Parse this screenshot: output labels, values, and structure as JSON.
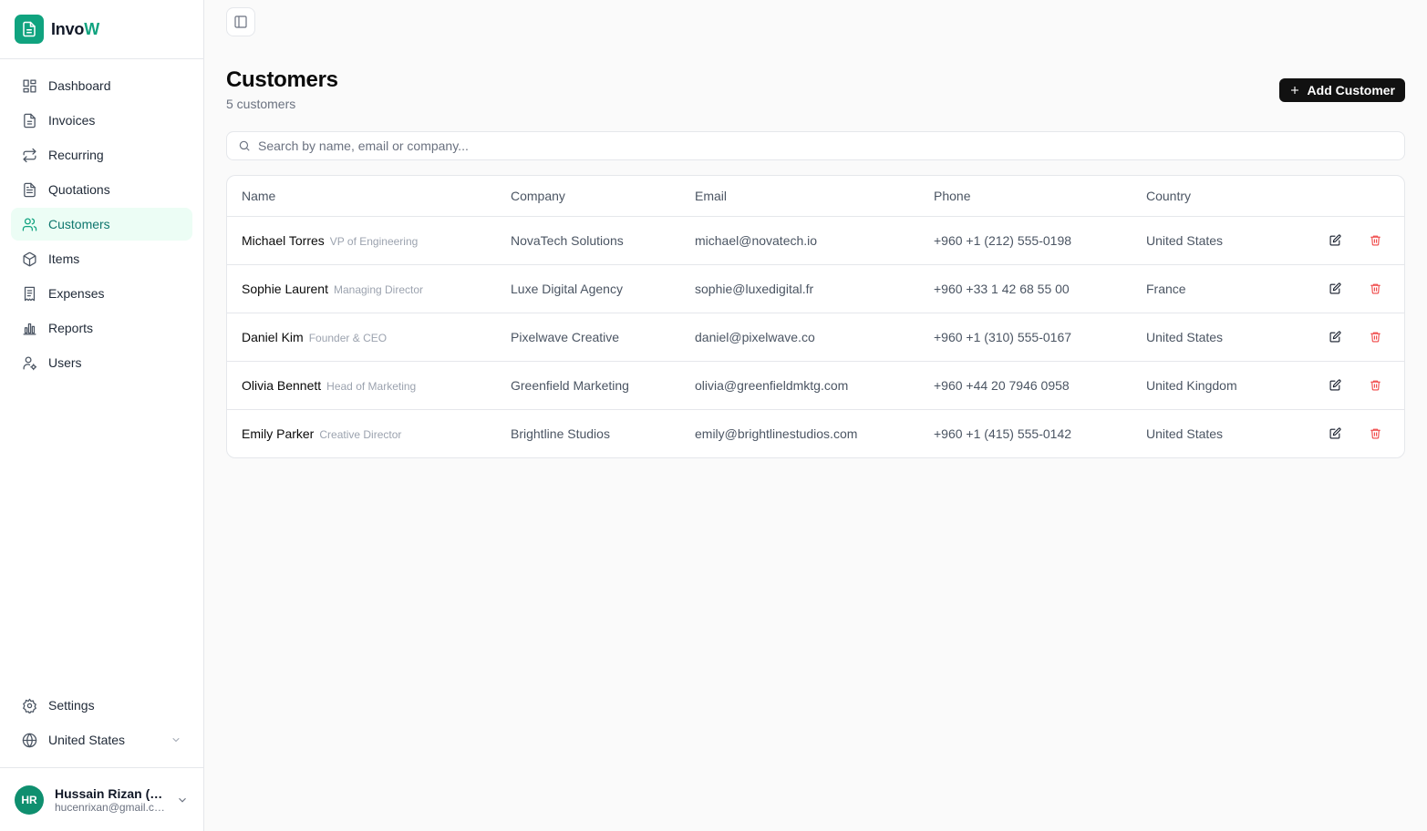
{
  "brand": {
    "name_main": "Invo",
    "name_accent": "W"
  },
  "sidebar": {
    "items": [
      {
        "label": "Dashboard",
        "icon": "dashboard-icon"
      },
      {
        "label": "Invoices",
        "icon": "file-text-icon"
      },
      {
        "label": "Recurring",
        "icon": "repeat-icon"
      },
      {
        "label": "Quotations",
        "icon": "file-lines-icon"
      },
      {
        "label": "Customers",
        "icon": "users-icon",
        "active": true
      },
      {
        "label": "Items",
        "icon": "package-icon"
      },
      {
        "label": "Expenses",
        "icon": "receipt-icon"
      },
      {
        "label": "Reports",
        "icon": "bar-chart-icon"
      },
      {
        "label": "Users",
        "icon": "user-cog-icon"
      }
    ],
    "settings_label": "Settings",
    "country_label": "United States"
  },
  "user": {
    "initials": "HR",
    "name": "Hussain Rizan (Ex",
    "email": "hucenrixan@gmail.com"
  },
  "header": {
    "title": "Customers",
    "subtitle": "5 customers",
    "add_button": "Add Customer"
  },
  "search": {
    "placeholder": "Search by name, email or company..."
  },
  "table": {
    "columns": [
      "Name",
      "Company",
      "Email",
      "Phone",
      "Country"
    ],
    "rows": [
      {
        "name": "Michael Torres",
        "role": "VP of Engineering",
        "company": "NovaTech Solutions",
        "email": "michael@novatech.io",
        "phone": "+960 +1 (212) 555-0198",
        "country": "United States"
      },
      {
        "name": "Sophie Laurent",
        "role": "Managing Director",
        "company": "Luxe Digital Agency",
        "email": "sophie@luxedigital.fr",
        "phone": "+960 +33 1 42 68 55 00",
        "country": "France"
      },
      {
        "name": "Daniel Kim",
        "role": "Founder & CEO",
        "company": "Pixelwave Creative",
        "email": "daniel@pixelwave.co",
        "phone": "+960 +1 (310) 555-0167",
        "country": "United States"
      },
      {
        "name": "Olivia Bennett",
        "role": "Head of Marketing",
        "company": "Greenfield Marketing",
        "email": "olivia@greenfieldmktg.com",
        "phone": "+960 +44 20 7946 0958",
        "country": "United Kingdom"
      },
      {
        "name": "Emily Parker",
        "role": "Creative Director",
        "company": "Brightline Studios",
        "email": "emily@brightlinestudios.com",
        "phone": "+960 +1 (415) 555-0142",
        "country": "United States"
      }
    ]
  },
  "colors": {
    "accent": "#10a37f",
    "danger": "#ef4444",
    "button_dark": "#111111"
  }
}
